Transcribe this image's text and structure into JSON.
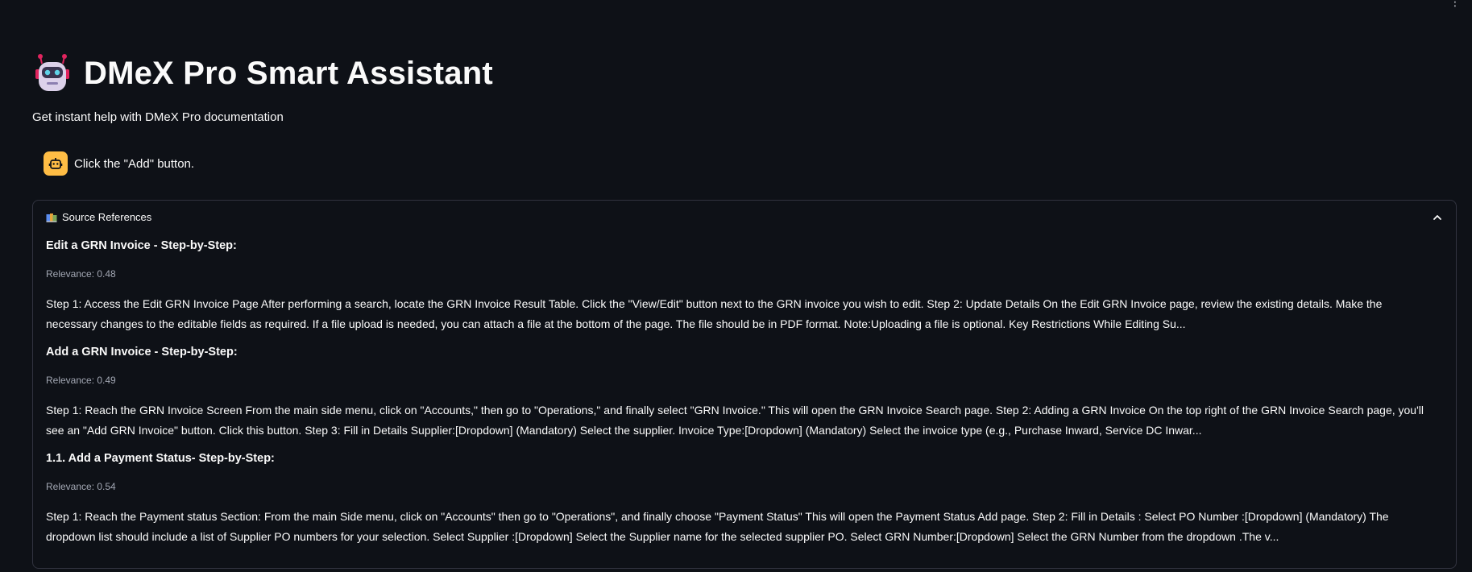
{
  "app": {
    "title": "DMeX Pro Smart Assistant",
    "subtitle": "Get instant help with DMeX Pro documentation",
    "menu_glyph": "⋮"
  },
  "chat": {
    "assistant_message": "Click the \"Add\" button.",
    "avatar_color": "#ffbd45"
  },
  "sources": {
    "label": "Source References",
    "expanded": true,
    "items": [
      {
        "title": "Edit a GRN Invoice - Step-by-Step:",
        "relevance": "Relevance: 0.48",
        "body": "Step 1: Access the Edit GRN Invoice Page After performing a search, locate the GRN Invoice Result Table. Click the \"View/Edit\" button next to the GRN invoice you wish to edit. Step 2: Update Details On the Edit GRN Invoice page, review the existing details. Make the necessary changes to the editable fields as required. If a file upload is needed, you can attach a file at the bottom of the page. The file should be in PDF format. Note:Uploading a file is optional. Key Restrictions While Editing Su..."
      },
      {
        "title": "Add a GRN Invoice - Step-by-Step:",
        "relevance": "Relevance: 0.49",
        "body": "Step 1: Reach the GRN Invoice Screen From the main side menu, click on \"Accounts,\" then go to \"Operations,\" and finally select \"GRN Invoice.\" This will open the GRN Invoice Search page. Step 2: Adding a GRN Invoice On the top right of the GRN Invoice Search page, you'll see an \"Add GRN Invoice\" button. Click this button. Step 3: Fill in Details Supplier:[Dropdown] (Mandatory) Select the supplier. Invoice Type:[Dropdown] (Mandatory) Select the invoice type (e.g., Purchase Inward, Service DC Inwar..."
      },
      {
        "title": "1.1. Add a Payment Status- Step-by-Step:",
        "relevance": "Relevance: 0.54",
        "body": "Step 1: Reach the Payment status Section: From the main Side menu, click on \"Accounts\" then go to \"Operations\", and finally choose \"Payment Status\" This will open the Payment Status Add page. Step 2: Fill in Details : Select PO Number :[Dropdown] (Mandatory) The dropdown list should include a list of Supplier PO numbers for your selection. Select Supplier :[Dropdown] Select the Supplier name for the selected supplier PO. Select GRN Number:[Dropdown] Select the GRN Number from the dropdown .The v..."
      }
    ]
  },
  "colors": {
    "background": "#0e1117",
    "text": "#fafafa",
    "muted": "#a3a8b4",
    "border": "#31333f"
  },
  "icons": {
    "header": "robot-icon",
    "avatar": "bot-avatar-icon",
    "sources": "books-icon",
    "collapse": "chevron-up-icon"
  }
}
